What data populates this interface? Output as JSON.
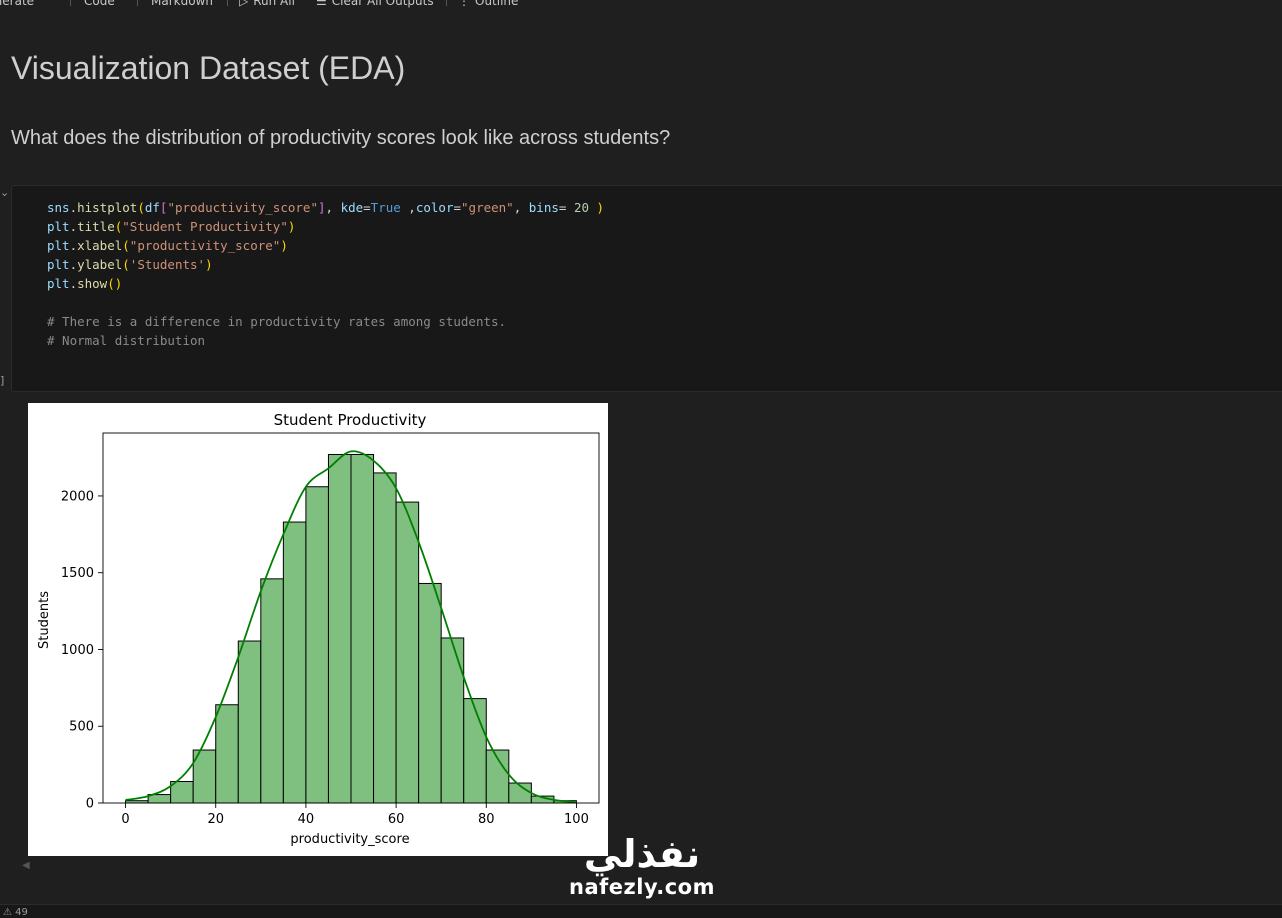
{
  "toolbar": {
    "items": [
      {
        "label": "Generate",
        "icon": "sparkle-icon"
      },
      {
        "label": "Code",
        "icon": "plus-icon"
      },
      {
        "label": "Markdown",
        "icon": "plus-icon"
      },
      {
        "label": "Run All",
        "icon": "run-all-icon"
      },
      {
        "label": "Clear All Outputs",
        "icon": "clear-outputs-icon"
      },
      {
        "label": "Outline",
        "icon": "outline-icon"
      }
    ]
  },
  "markdown": {
    "heading": "Visualization Dataset (EDA)",
    "question": "What does the distribution of productivity scores look like across students?"
  },
  "cell": {
    "execution_count": "]",
    "code_lines": [
      "sns.histplot(df[\"productivity_score\"], kde=True ,color=\"green\", bins= 20 )",
      "plt.title(\"Student Productivity\")",
      "plt.xlabel(\"productivity_score\")",
      "plt.ylabel('Students')",
      "plt.show()",
      "",
      "# There is a difference in productivity rates among students.",
      "# Normal distribution"
    ]
  },
  "chart_data": {
    "type": "bar",
    "title": "Student Productivity",
    "xlabel": "productivity_score",
    "ylabel": "Students",
    "bin_edges": [
      0,
      5,
      10,
      15,
      20,
      25,
      30,
      35,
      40,
      45,
      50,
      55,
      60,
      65,
      70,
      75,
      80,
      85,
      90,
      95,
      100
    ],
    "values": [
      15,
      55,
      140,
      345,
      640,
      1055,
      1460,
      1830,
      2060,
      2270,
      2270,
      2150,
      1960,
      1430,
      1075,
      680,
      345,
      130,
      45,
      15
    ],
    "kde": {
      "x": [
        0,
        5,
        10,
        15,
        20,
        25,
        30,
        35,
        40,
        45,
        50,
        55,
        60,
        65,
        70,
        75,
        80,
        85,
        90,
        95,
        100
      ],
      "y": [
        20,
        45,
        110,
        260,
        560,
        950,
        1380,
        1750,
        2060,
        2180,
        2290,
        2230,
        2050,
        1700,
        1270,
        820,
        430,
        185,
        65,
        20,
        5
      ]
    },
    "xlim": [
      -5,
      105
    ],
    "ylim": [
      0,
      2410
    ],
    "xticks": [
      0,
      20,
      40,
      60,
      80,
      100
    ],
    "yticks": [
      0,
      500,
      1000,
      1500,
      2000
    ],
    "bar_fill": "#7fbf7f",
    "bar_edge": "#000000",
    "kde_color": "#008000",
    "grid": false
  },
  "status": {
    "problems": "⚠ 49"
  },
  "watermark": {
    "arabic": "نفذلي",
    "latin": "nafezly.com"
  }
}
